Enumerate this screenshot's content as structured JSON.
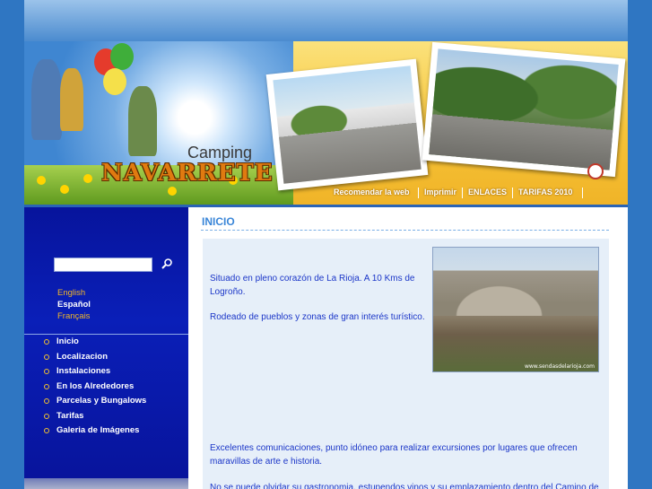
{
  "header": {
    "brand_small": "Camping",
    "brand_name": "NAVARRETE",
    "nav": [
      "Recomendar la web",
      "Imprimir",
      "ENLACES",
      "TARIFAS 2010"
    ]
  },
  "sidebar": {
    "search_value": "",
    "languages": [
      {
        "label": "English",
        "color": "#f2b728"
      },
      {
        "label": "Español",
        "color": "#ffffff"
      },
      {
        "label": "Français",
        "color": "#f2b728"
      }
    ],
    "menu": [
      "Inicio",
      "Localizacion",
      "Instalaciones",
      "En los Alrededores",
      "Parcelas y Bungalows",
      "Tarifas",
      "Galeria de Imágenes"
    ]
  },
  "main": {
    "title": "INICIO",
    "paragraphs": [
      "Situado en pleno corazón de La Rioja. A 10 Kms de",
      "Logroño.",
      "Rodeado de pueblos y zonas de gran interés turístico.",
      "Excelentes comunicaciones, punto idóneo para realizar excursiones por lugares que ofrecen",
      "maravillas de arte e historia.",
      "No se puede olvidar su gastronomia, estupendos vinos y su emplazamiento dentro del Camino de"
    ],
    "photo_credit": "www.sendasdelarioja.com"
  },
  "colors": {
    "sidebar_bg": "#0a1fb8",
    "title": "#3a86d8",
    "body_text": "#1b36c8",
    "accent": "#f2b728"
  }
}
